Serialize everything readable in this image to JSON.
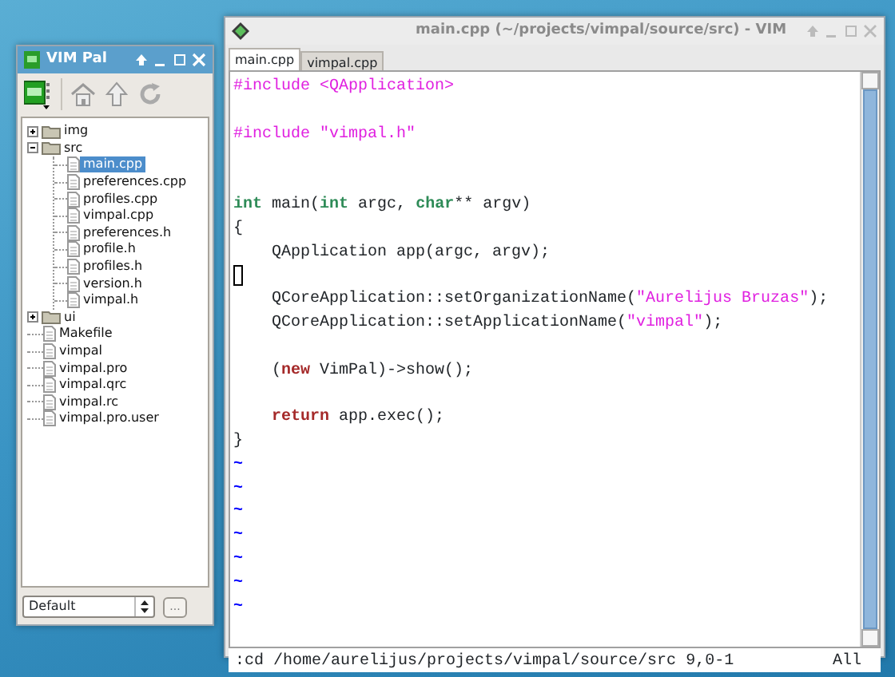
{
  "pal_window": {
    "title": "VIM Pal",
    "tree": [
      {
        "kind": "folder",
        "name": "img",
        "expanded": false,
        "selected": false
      },
      {
        "kind": "folder",
        "name": "src",
        "expanded": true,
        "selected": false,
        "children": [
          {
            "kind": "file",
            "name": "main.cpp",
            "selected": true
          },
          {
            "kind": "file",
            "name": "preferences.cpp",
            "selected": false
          },
          {
            "kind": "file",
            "name": "profiles.cpp",
            "selected": false
          },
          {
            "kind": "file",
            "name": "vimpal.cpp",
            "selected": false
          },
          {
            "kind": "file",
            "name": "preferences.h",
            "selected": false
          },
          {
            "kind": "file",
            "name": "profile.h",
            "selected": false
          },
          {
            "kind": "file",
            "name": "profiles.h",
            "selected": false
          },
          {
            "kind": "file",
            "name": "version.h",
            "selected": false
          },
          {
            "kind": "file",
            "name": "vimpal.h",
            "selected": false
          }
        ]
      },
      {
        "kind": "folder",
        "name": "ui",
        "expanded": false,
        "selected": false
      },
      {
        "kind": "file",
        "name": "Makefile",
        "selected": false
      },
      {
        "kind": "file",
        "name": "vimpal",
        "selected": false
      },
      {
        "kind": "file",
        "name": "vimpal.pro",
        "selected": false
      },
      {
        "kind": "file",
        "name": "vimpal.qrc",
        "selected": false
      },
      {
        "kind": "file",
        "name": "vimpal.rc",
        "selected": false
      },
      {
        "kind": "file",
        "name": "vimpal.pro.user",
        "selected": false
      }
    ],
    "profile_select": {
      "value": "Default"
    },
    "more_button": {
      "label": "..."
    }
  },
  "vim_window": {
    "title": "main.cpp (~/projects/vimpal/source/src) - VIM",
    "tabs": [
      {
        "label": "main.cpp",
        "selected": true
      },
      {
        "label": "vimpal.cpp",
        "selected": false
      }
    ],
    "lines": [
      {
        "kind": "code",
        "cursor": false,
        "tokens": [
          {
            "kind": "preproc",
            "text": "#include <QApplication>"
          }
        ]
      },
      {
        "kind": "blank",
        "cursor": false
      },
      {
        "kind": "code",
        "cursor": false,
        "tokens": [
          {
            "kind": "preproc",
            "text": "#include \"vimpal.h\""
          }
        ]
      },
      {
        "kind": "blank",
        "cursor": false
      },
      {
        "kind": "blank",
        "cursor": false
      },
      {
        "kind": "code",
        "cursor": false,
        "tokens": [
          {
            "kind": "type",
            "text": "int"
          },
          {
            "kind": "normal",
            "text": " main("
          },
          {
            "kind": "type",
            "text": "int"
          },
          {
            "kind": "normal",
            "text": " argc, "
          },
          {
            "kind": "type",
            "text": "char"
          },
          {
            "kind": "normal",
            "text": "** argv)"
          }
        ]
      },
      {
        "kind": "code",
        "cursor": false,
        "tokens": [
          {
            "kind": "normal",
            "text": "{"
          }
        ]
      },
      {
        "kind": "code",
        "cursor": false,
        "tokens": [
          {
            "kind": "normal",
            "text": "    QApplication app(argc, argv);"
          }
        ]
      },
      {
        "kind": "blank",
        "cursor": true
      },
      {
        "kind": "code",
        "cursor": false,
        "tokens": [
          {
            "kind": "normal",
            "text": "    QCoreApplication::setOrganizationName("
          },
          {
            "kind": "string",
            "text": "\"Aurelijus Bruzas\""
          },
          {
            "kind": "normal",
            "text": ");"
          }
        ]
      },
      {
        "kind": "code",
        "cursor": false,
        "tokens": [
          {
            "kind": "normal",
            "text": "    QCoreApplication::setApplicationName("
          },
          {
            "kind": "string",
            "text": "\"vimpal\""
          },
          {
            "kind": "normal",
            "text": ");"
          }
        ]
      },
      {
        "kind": "blank",
        "cursor": false
      },
      {
        "kind": "code",
        "cursor": false,
        "tokens": [
          {
            "kind": "normal",
            "text": "    ("
          },
          {
            "kind": "statement",
            "text": "new"
          },
          {
            "kind": "normal",
            "text": " VimPal)->show();"
          }
        ]
      },
      {
        "kind": "blank",
        "cursor": false
      },
      {
        "kind": "code",
        "cursor": false,
        "indented": true,
        "tokens": [
          {
            "kind": "statement",
            "text": "return"
          },
          {
            "kind": "normal",
            "text": " app.exec();"
          }
        ]
      },
      {
        "kind": "code",
        "cursor": false,
        "tokens": [
          {
            "kind": "normal",
            "text": "}"
          }
        ]
      },
      {
        "kind": "filler",
        "text": "~"
      },
      {
        "kind": "filler",
        "text": "~"
      },
      {
        "kind": "filler",
        "text": "~"
      },
      {
        "kind": "filler",
        "text": "~"
      },
      {
        "kind": "filler",
        "text": "~"
      },
      {
        "kind": "filler",
        "text": "~"
      },
      {
        "kind": "filler",
        "text": "~"
      }
    ],
    "command_line": ":cd /home/aurelijus/projects/vimpal/source/src",
    "position": "9,0-1",
    "scroll_position": "All"
  }
}
